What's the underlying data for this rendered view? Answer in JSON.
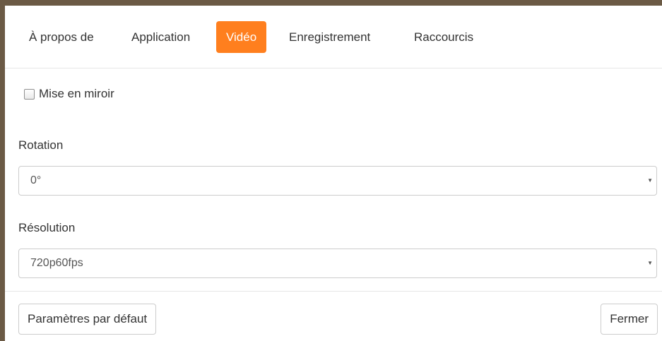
{
  "tabs": [
    {
      "label": "À propos de",
      "active": false
    },
    {
      "label": "Application",
      "active": false
    },
    {
      "label": "Vidéo",
      "active": true
    },
    {
      "label": "Enregistrement",
      "active": false
    },
    {
      "label": "Raccourcis",
      "active": false
    }
  ],
  "mirror": {
    "label": "Mise en miroir",
    "checked": false
  },
  "rotation": {
    "label": "Rotation",
    "value": "0°"
  },
  "resolution": {
    "label": "Résolution",
    "value": "720p60fps"
  },
  "footer": {
    "defaults_label": "Paramètres par défaut",
    "close_label": "Fermer"
  },
  "colors": {
    "accent": "#ff7f1e",
    "frame_border": "#6b5a45"
  },
  "icons": {
    "select_arrow": "caret-down-icon"
  }
}
